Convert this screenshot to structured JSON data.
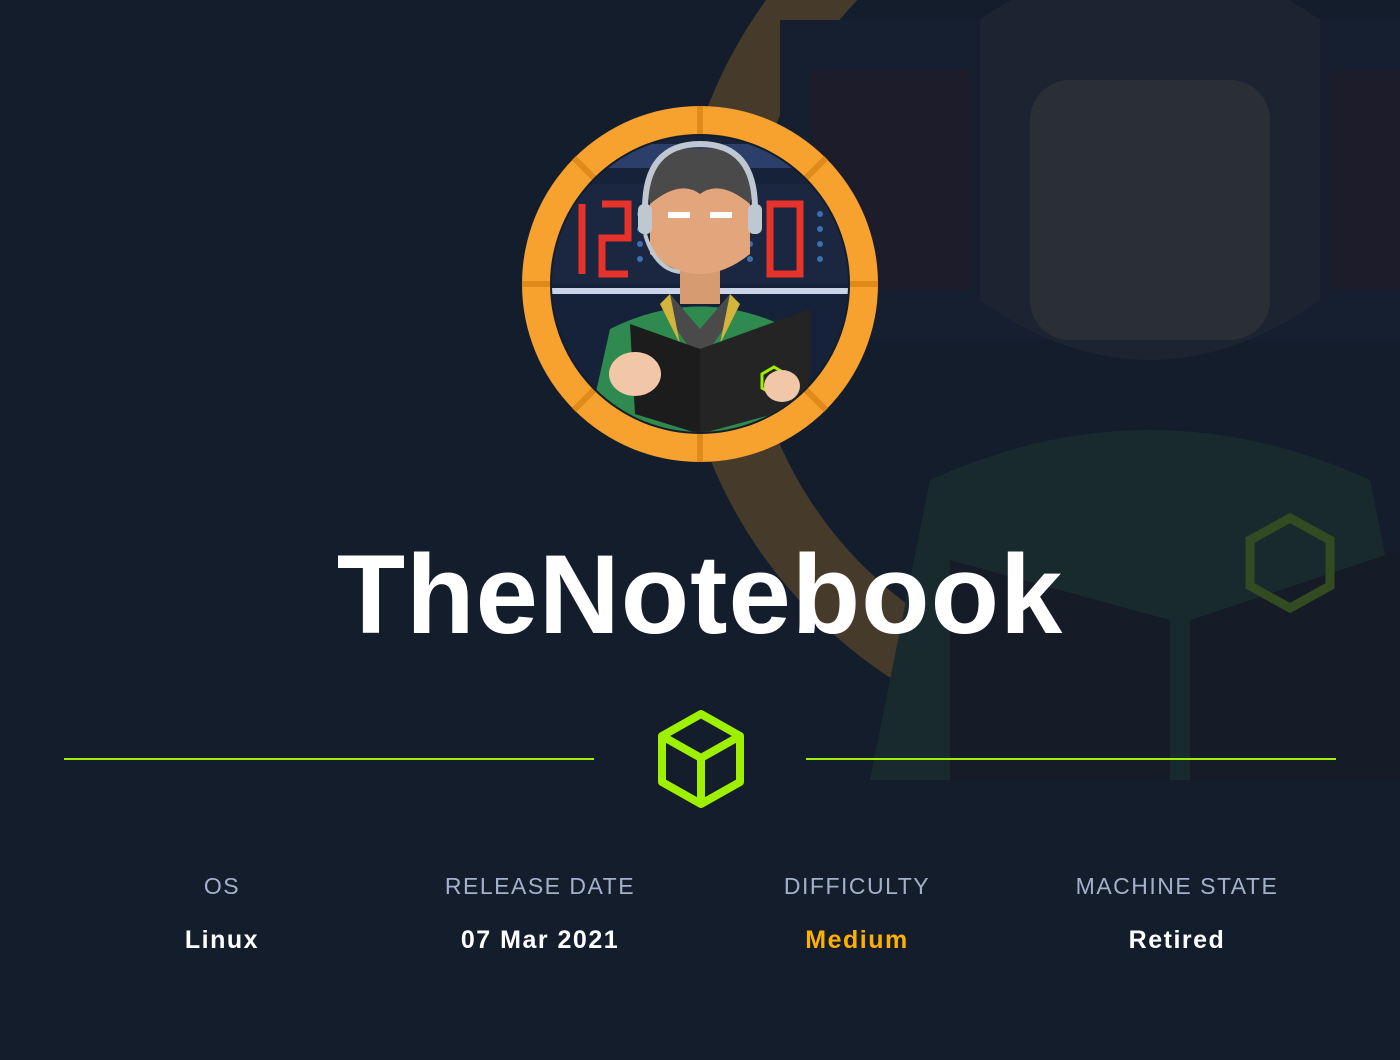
{
  "machine": {
    "name": "TheNotebook"
  },
  "stats": [
    {
      "label": "OS",
      "value": "Linux"
    },
    {
      "label": "RELEASE DATE",
      "value": "07 Mar 2021"
    },
    {
      "label": "DIFFICULTY",
      "value": "Medium"
    },
    {
      "label": "MACHINE STATE",
      "value": "Retired"
    }
  ],
  "icons": {
    "avatar": "machine-avatar",
    "divider": "cube-icon"
  },
  "colors": {
    "background": "#141d2b",
    "accent": "#9fef00",
    "difficulty_medium": "#ffaf00",
    "label": "#a4b1cd",
    "avatar_ring": "#f7a12f"
  }
}
